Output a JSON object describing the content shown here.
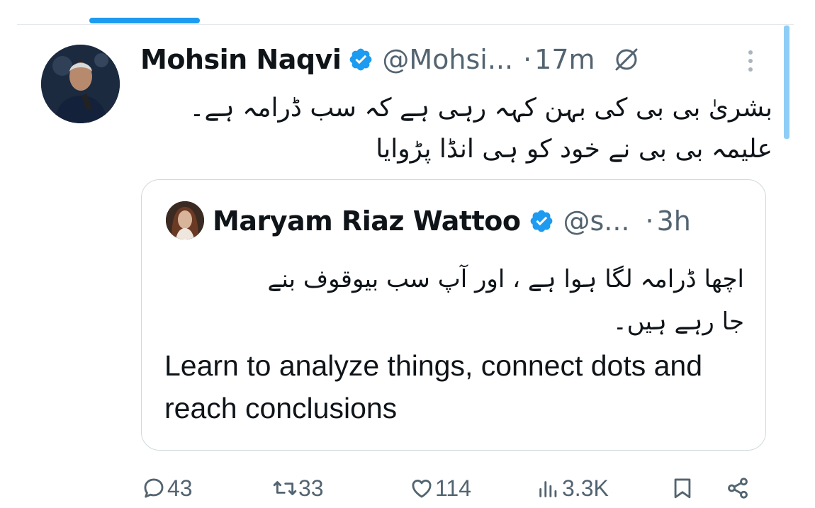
{
  "tweet": {
    "author_name": "Mohsin Naqvi",
    "handle": "@Mohsi...",
    "separator": "·",
    "time": "17m",
    "text_lines": [
      "بشریٰ بی بی کی بہن کہہ رہی ہے کہ سب ڈرامہ ہے۔",
      "علیمہ بی بی نے خود کو ہی انڈا پڑوایا"
    ]
  },
  "quote": {
    "author_name": "Maryam Riaz Wattoo",
    "handle": "@s...",
    "separator": "·",
    "time": "3h",
    "urdu_lines": [
      "اچھا ڈرامہ لگا ہوا ہے ، اور آپ سب بیوقوف بنے",
      "جا رہے ہیں۔"
    ],
    "english_text": "Learn to analyze things, connect dots and reach conclusions"
  },
  "actions": {
    "replies": "43",
    "reposts": "33",
    "likes": "114",
    "views": "3.3K"
  },
  "colors": {
    "accent": "#1d9bf0",
    "secondary_text": "#536471",
    "primary_text": "#0f1419",
    "border": "#cfd9de"
  },
  "icons": [
    "verified-badge-icon",
    "mute-icon",
    "more-icon",
    "reply-icon",
    "repost-icon",
    "like-icon",
    "views-icon",
    "bookmark-icon",
    "share-icon"
  ]
}
